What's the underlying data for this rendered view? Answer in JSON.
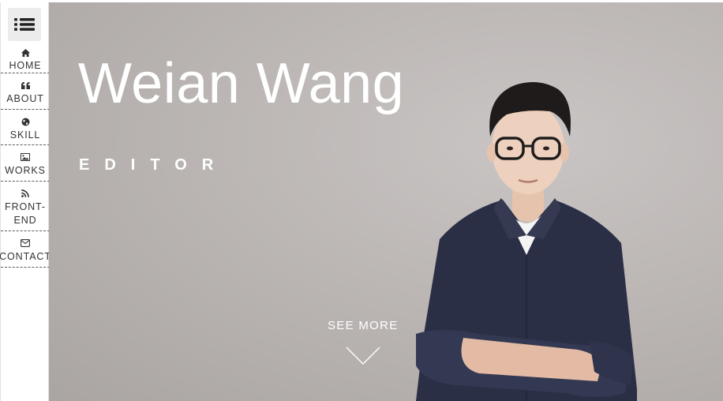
{
  "sidebar": {
    "menu_icon": "list-icon",
    "items": [
      {
        "label": "HOME",
        "icon": "home-icon"
      },
      {
        "label": "ABOUT",
        "icon": "quote-icon"
      },
      {
        "label": "SKILL",
        "icon": "globe-icon"
      },
      {
        "label": "WORKS",
        "icon": "image-icon"
      },
      {
        "label": "FRONT-END",
        "icon": "rss-icon"
      },
      {
        "label": "CONTACT",
        "icon": "envelope-icon"
      }
    ]
  },
  "hero": {
    "name": "Weian Wang",
    "role": "EDITOR",
    "cta": "SEE MORE",
    "cta_icon": "chevron-down-icon",
    "photo": "portrait-photo"
  },
  "colors": {
    "hero_bg": "#bdb8b6",
    "shirt": "#2b2f45",
    "text_light": "#ffffff",
    "sidebar_text": "#333333"
  }
}
